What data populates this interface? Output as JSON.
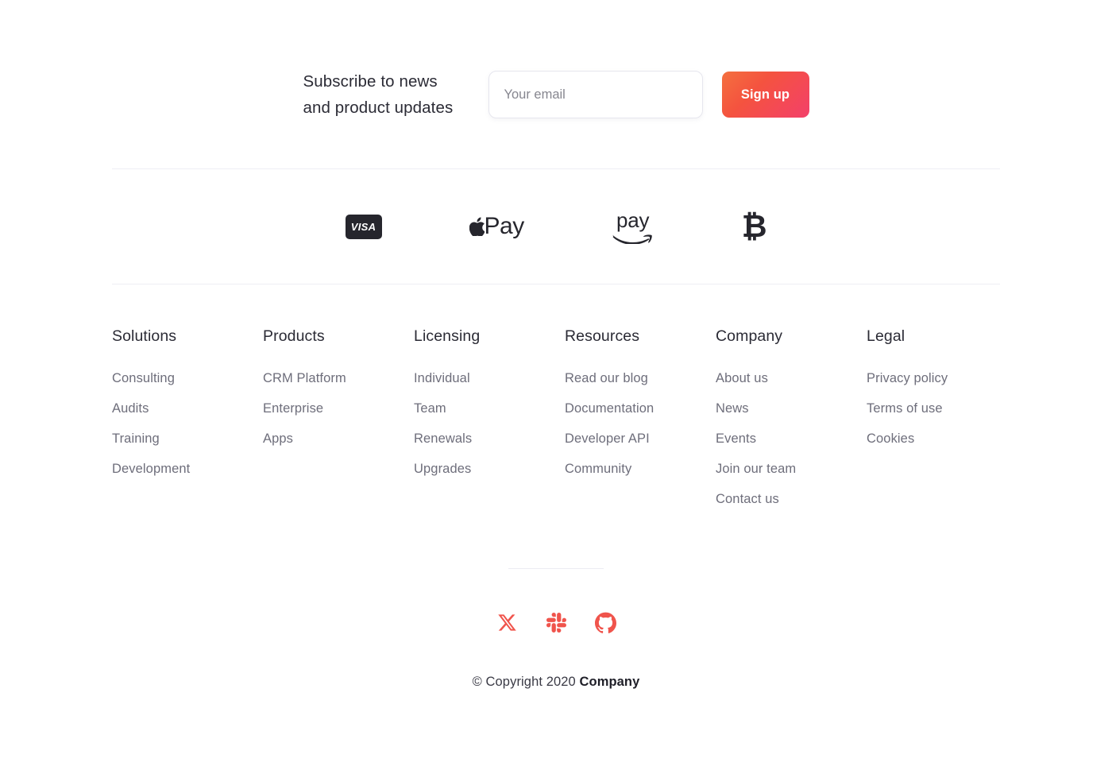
{
  "subscribe": {
    "heading_line1": "Subscribe to news",
    "heading_line2": "and product updates",
    "email_placeholder": "Your email",
    "email_value": "",
    "signup_label": "Sign up"
  },
  "payments": [
    {
      "name": "visa",
      "label": "VISA"
    },
    {
      "name": "apple-pay",
      "label": "Pay"
    },
    {
      "name": "amazon-pay",
      "label": "pay"
    },
    {
      "name": "bitcoin",
      "label": "₿"
    }
  ],
  "columns": [
    {
      "title": "Solutions",
      "links": [
        "Consulting",
        "Audits",
        "Training",
        "Development"
      ]
    },
    {
      "title": "Products",
      "links": [
        "CRM Platform",
        "Enterprise",
        "Apps"
      ]
    },
    {
      "title": "Licensing",
      "links": [
        "Individual",
        "Team",
        "Renewals",
        "Upgrades"
      ]
    },
    {
      "title": "Resources",
      "links": [
        "Read our blog",
        "Documentation",
        "Developer API",
        "Community"
      ]
    },
    {
      "title": "Company",
      "links": [
        "About us",
        "News",
        "Events",
        "Join our team",
        "Contact us"
      ]
    },
    {
      "title": "Legal",
      "links": [
        "Privacy policy",
        "Terms of use",
        "Cookies"
      ]
    }
  ],
  "socials": [
    {
      "name": "x-twitter-icon",
      "label": "X"
    },
    {
      "name": "slack-icon",
      "label": "Slack"
    },
    {
      "name": "github-icon",
      "label": "GitHub"
    }
  ],
  "copyright": {
    "prefix": "© Copyright 2020 ",
    "company": "Company"
  },
  "colors": {
    "accent_red": "#f0544c",
    "button_gradient_start": "#f4703f",
    "button_gradient_end": "#f3406a",
    "text_dark": "#2b2b35",
    "text_muted": "#6e6e7b",
    "divider": "#eeeef4",
    "payment_dark": "#26262d"
  }
}
